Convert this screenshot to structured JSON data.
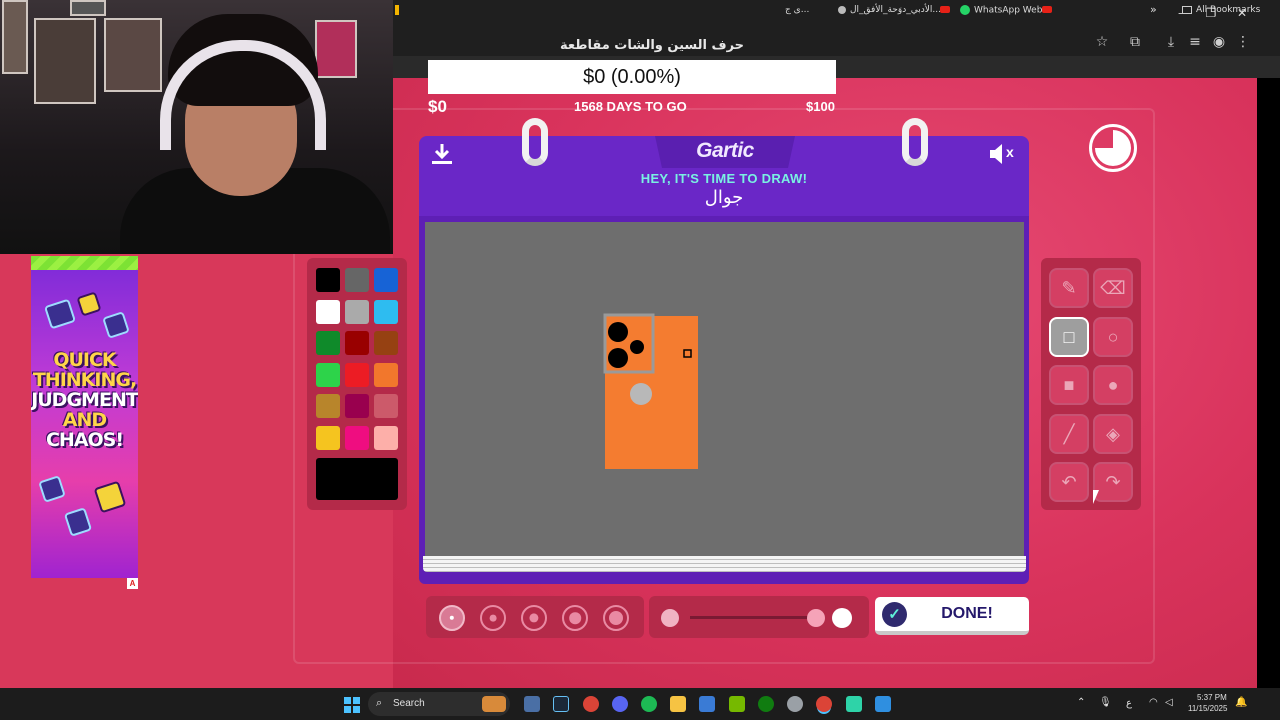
{
  "browser": {
    "tab_title": "حرف السين والشات مقاطعة",
    "bookmarks": [
      "الأدبي_دوَحة_الأفق_ال...",
      "WhatsApp Web"
    ],
    "bookmark_left": "ى ج...",
    "all_bookmarks": "All Bookmarks",
    "chevron": "»",
    "controls": {
      "minimize": "–",
      "restore": "❐",
      "close": "✕"
    }
  },
  "overlay": {
    "goal_amount": "$0 (0.00%)",
    "goal_start": "$0",
    "days_to_go": "1568 DAYS TO GO",
    "goal_end": "$100"
  },
  "ad": {
    "lines": [
      "QUICK",
      "THINKING,",
      "JUDGMENT",
      "AND",
      "CHAOS!"
    ],
    "corner": "A"
  },
  "game": {
    "logo": "Gartic",
    "prompt": "HEY, IT'S TIME TO DRAW!",
    "word": "جوال",
    "mute_label": "x",
    "done_label": "DONE!",
    "download_icon": "download-icon",
    "timer_icon": "timer-icon"
  },
  "palette": {
    "colors": [
      "#000000",
      "#666666",
      "#1763d6",
      "#ffffff",
      "#aaaaaa",
      "#2ebcf0",
      "#0f8a2a",
      "#990000",
      "#964112",
      "#2dd34a",
      "#ec1c24",
      "#f2772c",
      "#b8852b",
      "#99004e",
      "#cc5a6a",
      "#f5c41f",
      "#ef0d80",
      "#fdafa9"
    ],
    "current": "#000000"
  },
  "tools": [
    {
      "name": "pencil",
      "glyph": "✎",
      "active": false
    },
    {
      "name": "eraser",
      "glyph": "⌫",
      "active": false
    },
    {
      "name": "rectangle-outline",
      "glyph": "□",
      "active": true
    },
    {
      "name": "ellipse-outline",
      "glyph": "○",
      "active": false
    },
    {
      "name": "rectangle-filled",
      "glyph": "■",
      "active": false
    },
    {
      "name": "ellipse-filled",
      "glyph": "●",
      "active": false
    },
    {
      "name": "line",
      "glyph": "╱",
      "active": false
    },
    {
      "name": "fill",
      "glyph": "◈",
      "active": false
    },
    {
      "name": "undo",
      "glyph": "↶",
      "active": false
    },
    {
      "name": "redo",
      "glyph": "↷",
      "active": false
    }
  ],
  "brush_sizes": [
    1,
    2,
    3,
    4,
    5
  ],
  "opacity": {
    "min_icon": "dot",
    "max_icon": "dot"
  },
  "drawing": {
    "body_color": "#f47c30",
    "camera_color": "#9a9a9a",
    "lens_color": "#000000",
    "logo_color": "#b8b8b8"
  },
  "taskbar": {
    "search_label": "Search",
    "time": "5:37 PM",
    "date": "11/15/2025",
    "lang": "ع"
  }
}
